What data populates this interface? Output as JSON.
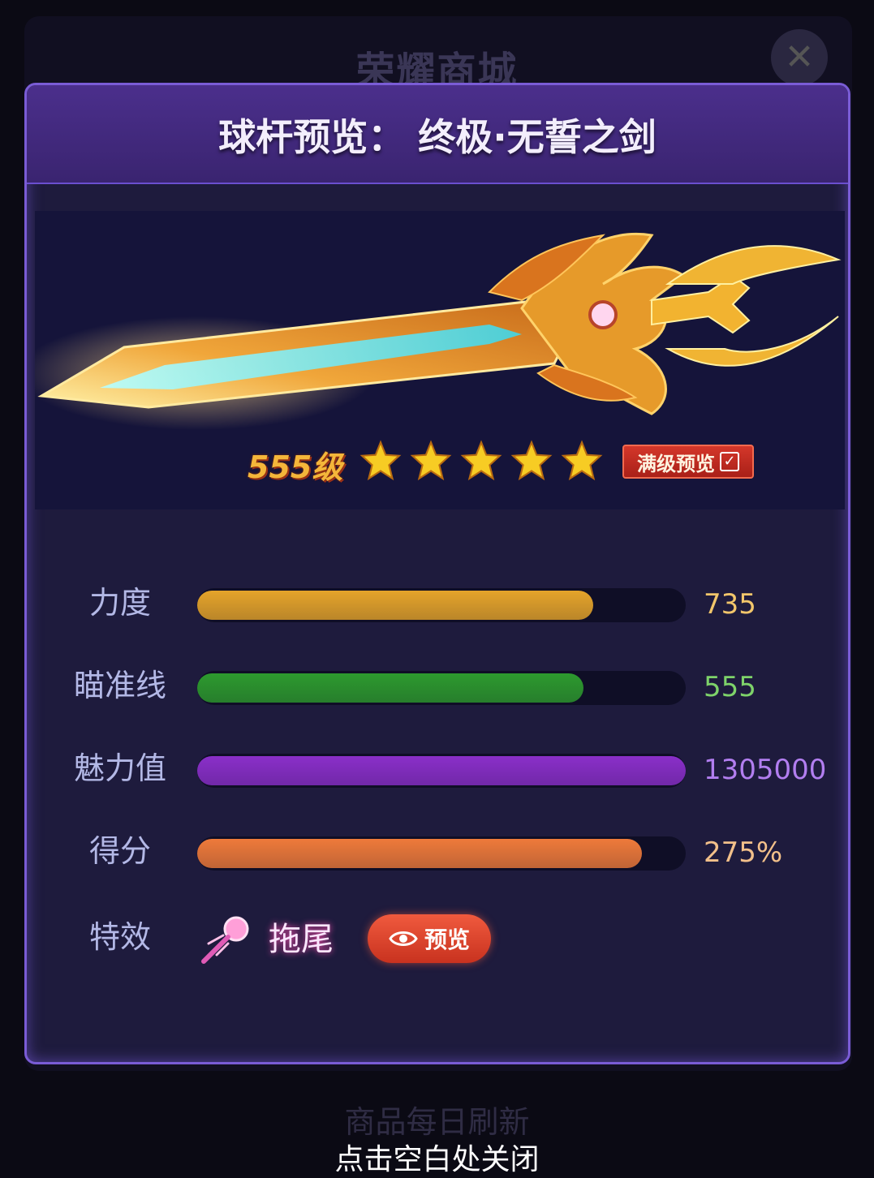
{
  "background": {
    "shop_title": "荣耀商城",
    "close_icon": "close-icon"
  },
  "dialog": {
    "title": "球杆预览： 终极·无誓之剑",
    "level": "555级",
    "stars": 5,
    "full_preview_label": "满级预览",
    "full_preview_checked": true
  },
  "stats": [
    {
      "label": "力度",
      "value": "735",
      "fill": 0.81,
      "color": "#e5a42a",
      "value_color": "#f2c66b"
    },
    {
      "label": "瞄准线",
      "value": "555",
      "fill": 0.79,
      "color": "#2d9a2e",
      "value_color": "#7ed36a"
    },
    {
      "label": "魅力值",
      "value": "1305000",
      "fill": 1.0,
      "color": "#8a2fc9",
      "value_color": "#b27ef0"
    },
    {
      "label": "得分",
      "value": "275%",
      "fill": 0.91,
      "color": "#ee7a3a",
      "value_color": "#f2c08a"
    }
  ],
  "effect": {
    "label": "特效",
    "name": "拖尾",
    "preview_label": "预览",
    "icon": "trail-icon"
  },
  "footer": {
    "refresh_text": "商品每日刷新",
    "close_hint": "点击空白处关闭"
  }
}
